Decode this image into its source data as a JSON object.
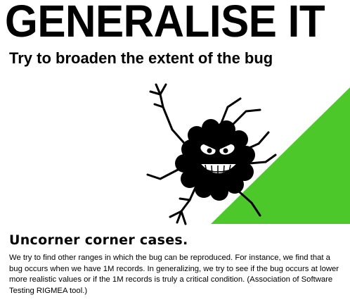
{
  "slide": {
    "title": "GENERALISE IT",
    "subtitle": "Try to broaden the extent of the bug",
    "section_heading": "Uncorner corner cases.",
    "body_text": "We try to find other ranges in which the bug can be reproduced. For instance, we find that a bug occurs when we have 1M records. In generalizing, we try to see if the bug occurs at lower more realistic values or if the 1M records is truly a critical condition. (Association of Software Testing RIGMEA tool.)"
  },
  "illustration": {
    "icon": "angry-bug-icon",
    "accent_color": "#4cc82a"
  }
}
